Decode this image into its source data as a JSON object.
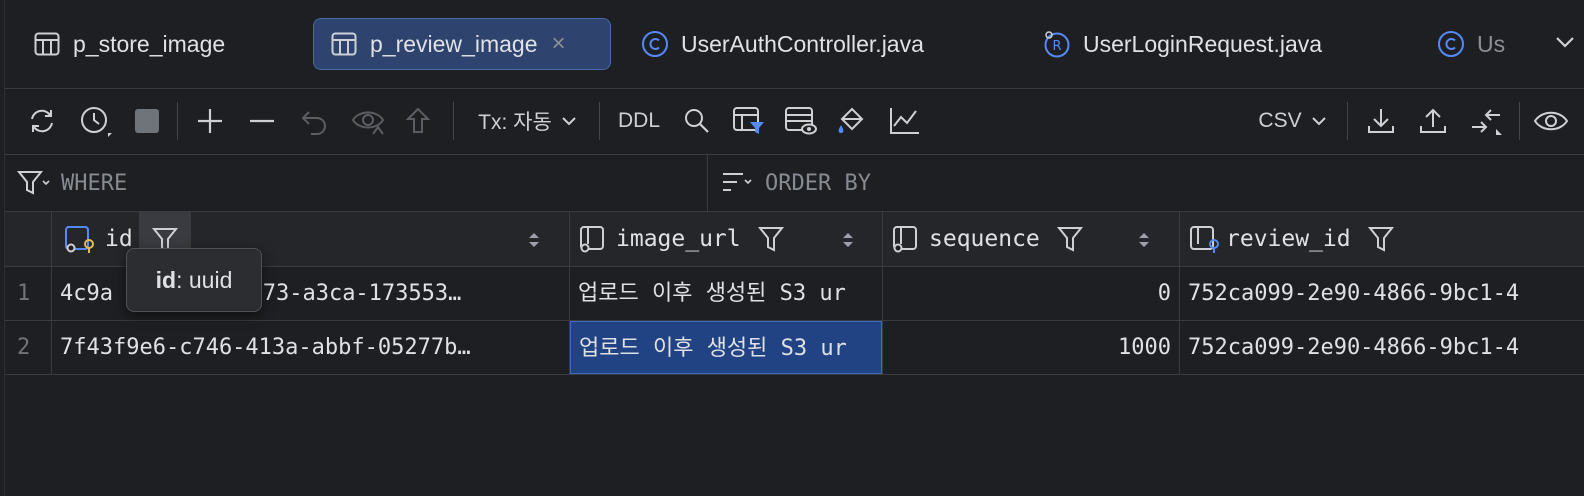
{
  "tabs": [
    {
      "label": "p_store_image",
      "icon": "table-icon",
      "active": false
    },
    {
      "label": "p_review_image",
      "icon": "table-icon",
      "active": true,
      "close": "×"
    },
    {
      "label": "UserAuthController.java",
      "icon": "class-icon",
      "active": false
    },
    {
      "label": "UserLoginRequest.java",
      "icon": "record-icon",
      "active": false
    },
    {
      "label": "Us",
      "icon": "class-icon",
      "active": false
    }
  ],
  "toolbar": {
    "tx_label": "Tx: 자동",
    "ddl_label": "DDL",
    "export_format": "CSV"
  },
  "filter": {
    "where_label": "WHERE",
    "order_by_label": "ORDER BY"
  },
  "columns": [
    {
      "name": "id"
    },
    {
      "name": "image_url"
    },
    {
      "name": "sequence"
    },
    {
      "name": "review_id"
    }
  ],
  "rows": [
    {
      "num": "1",
      "id": "4c9a",
      "id_tail": "-4e73-a3ca-173553…",
      "image_url": "업로드 이후 생성된 S3 ur",
      "sequence": "0",
      "review_id": "752ca099-2e90-4866-9bc1-4"
    },
    {
      "num": "2",
      "id": "7f43f9e6-c746-413a-abbf-05277b…",
      "id_tail": "",
      "image_url": "업로드 이후 생성된 S3 ur",
      "sequence": "1000",
      "review_id": "752ca099-2e90-4866-9bc1-4"
    }
  ],
  "tooltip": {
    "key": "id",
    "value": ": uuid"
  }
}
